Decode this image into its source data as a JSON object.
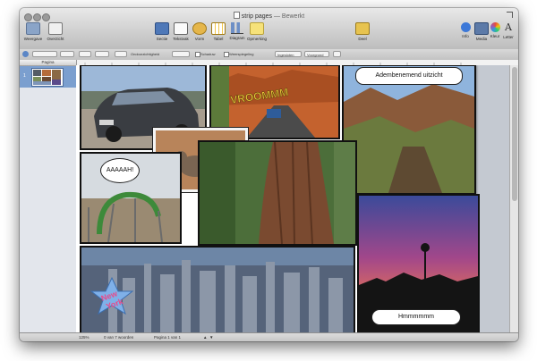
{
  "window": {
    "title": "strip pages",
    "edited": "— Bewerkt"
  },
  "toolbar": {
    "left": [
      {
        "label": "Weergave",
        "icon": "view-icon"
      },
      {
        "label": "Overzicht",
        "icon": "overview-icon"
      }
    ],
    "middle": [
      {
        "label": "Sectie",
        "icon": "section-icon"
      },
      {
        "label": "Tekstvak",
        "icon": "textbox-icon"
      },
      {
        "label": "Vorm",
        "icon": "shape-icon"
      },
      {
        "label": "Tabel",
        "icon": "table-icon"
      },
      {
        "label": "Diagram",
        "icon": "chart-icon"
      },
      {
        "label": "Opmerking",
        "icon": "comment-icon"
      }
    ],
    "share": {
      "label": "Deel",
      "icon": "share-icon"
    },
    "right": [
      {
        "label": "Info",
        "icon": "info-icon"
      },
      {
        "label": "Media",
        "icon": "media-icon"
      },
      {
        "label": "Kleur",
        "icon": "color-icon"
      },
      {
        "label": "Letter",
        "icon": "font-icon"
      }
    ]
  },
  "formatbar": {
    "opacity_label": "Ondoorzichtigheid",
    "shadow_label": "Schaduw",
    "reflection_label": "Weerspiegeling",
    "wrap_label": "Ingesloten",
    "front_label": "Voorgrond"
  },
  "sidebar": {
    "header": "Pagina",
    "pages": [
      {
        "number": "1"
      }
    ]
  },
  "captions": {
    "top_right": "Adembenemend uitzicht",
    "bottom_right": "Hmmmmmm",
    "aaah": "AAAAAH!",
    "vroom": "VROOMMM",
    "star_line1": "New",
    "star_line2": "York"
  },
  "status": {
    "zoom": "125%",
    "words": "0 van 7 woorden",
    "page": "Pagina 1 van 1"
  },
  "colors": {
    "selection_blue": "#7b9fcf",
    "star_fill": "#7fb0e8"
  }
}
